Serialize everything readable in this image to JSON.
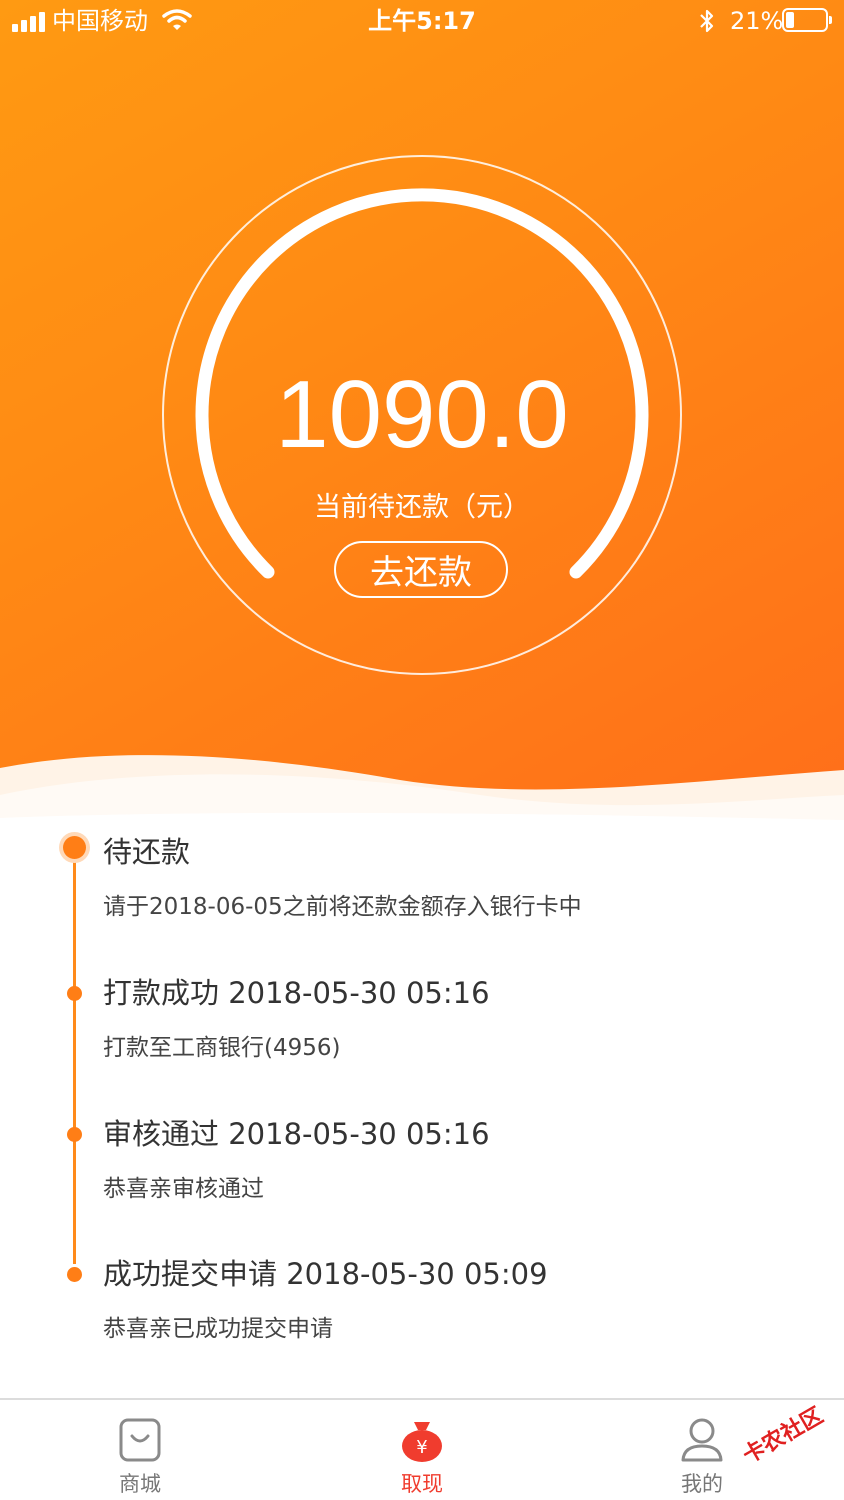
{
  "status_bar": {
    "carrier": "中国移动",
    "time": "上午5:17",
    "battery": "21%",
    "battery_level": 0.21
  },
  "summary": {
    "amount": "1090.0",
    "amount_label": "当前待还款（元）",
    "repay_button": "去还款"
  },
  "timeline": [
    {
      "title": "待还款",
      "desc": "请于2018-06-05之前将还款金额存入银行卡中",
      "current": true
    },
    {
      "title": "打款成功 2018-05-30 05:16",
      "desc": "打款至工商银行(4956)",
      "current": false
    },
    {
      "title": "审核通过 2018-05-30 05:16",
      "desc": "恭喜亲审核通过",
      "current": false
    },
    {
      "title": "成功提交申请 2018-05-30 05:09",
      "desc": "恭喜亲已成功提交申请",
      "current": false
    }
  ],
  "tabbar": {
    "items": [
      {
        "label": "商城",
        "icon": "shopping-bag-icon",
        "active": false
      },
      {
        "label": "取现",
        "icon": "money-bag-icon",
        "active": true
      },
      {
        "label": "我的",
        "icon": "person-icon",
        "active": false
      }
    ]
  },
  "watermark": "卡农社区",
  "colors": {
    "accent": "#ff8a14",
    "active_tab": "#f03c2e"
  }
}
